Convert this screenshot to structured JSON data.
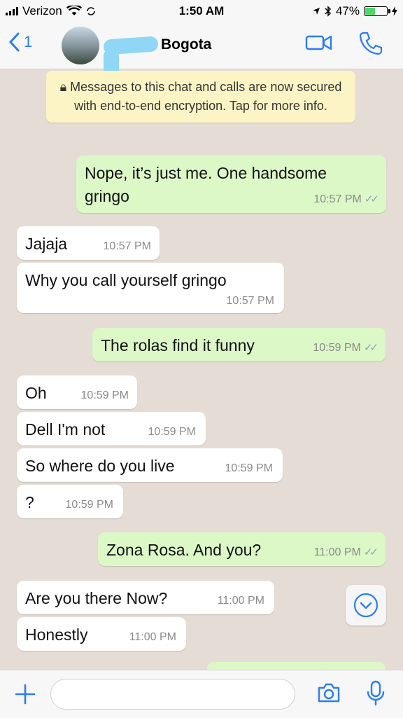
{
  "status": {
    "carrier": "Verizon",
    "time": "1:50 AM",
    "battery": "47%",
    "battery_level": 0.47,
    "battery_color": "#4cd964"
  },
  "header": {
    "back_count": "1",
    "contact": "Bogota",
    "accent": "#2b7cf6"
  },
  "notice": {
    "text": "Messages to this chat and calls are now secured with end-to-end encryption. Tap for more info."
  },
  "messages": [
    {
      "dir": "out",
      "text": "Nope, it’s just me. One handsome gringo",
      "time": "10:57 PM",
      "read": true
    },
    {
      "dir": "in",
      "text": "Jajaja",
      "time": "10:57 PM"
    },
    {
      "dir": "in",
      "text": "Why you call yourself gringo",
      "time": "10:57 PM"
    },
    {
      "dir": "out",
      "text": "The rolas find it funny",
      "time": "10:59 PM",
      "read": true
    },
    {
      "dir": "in",
      "text": "Oh",
      "time": "10:59 PM"
    },
    {
      "dir": "in",
      "text": "Dell I'm not",
      "time": "10:59 PM"
    },
    {
      "dir": "in",
      "text": "So where do you live",
      "time": "10:59 PM"
    },
    {
      "dir": "in",
      "text": "?",
      "time": "10:59 PM"
    },
    {
      "dir": "out",
      "text": "Zona Rosa. And you?",
      "time": "11:00 PM",
      "read": true
    },
    {
      "dir": "in",
      "text": "Are you there Now?",
      "time": "11:00 PM"
    },
    {
      "dir": "in",
      "text": "Honestly",
      "time": "11:00 PM"
    }
  ],
  "colors": {
    "out_bubble": "#dcf8c6",
    "in_bubble": "#ffffff",
    "wallpaper": "#e5ddd5",
    "read_ticks": "#8fa3b5"
  },
  "icons": {
    "back": "chevron-left-icon",
    "video": "video-camera-icon",
    "call": "phone-icon",
    "scroll": "chevron-down-icon",
    "attach": "plus-icon",
    "camera": "camera-icon",
    "mic": "microphone-icon"
  }
}
